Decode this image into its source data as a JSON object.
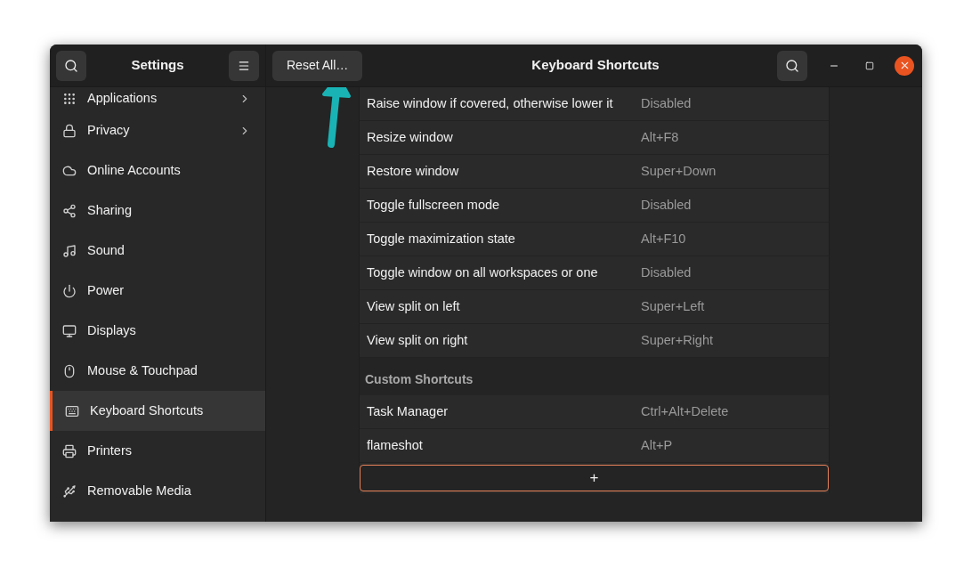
{
  "sidebar": {
    "title": "Settings",
    "items": [
      {
        "label": "Applications",
        "submenu": true,
        "selected": false
      },
      {
        "label": "Privacy",
        "submenu": true,
        "selected": false
      },
      {
        "label": "Online Accounts",
        "submenu": false,
        "selected": false
      },
      {
        "label": "Sharing",
        "submenu": false,
        "selected": false
      },
      {
        "label": "Sound",
        "submenu": false,
        "selected": false
      },
      {
        "label": "Power",
        "submenu": false,
        "selected": false
      },
      {
        "label": "Displays",
        "submenu": false,
        "selected": false
      },
      {
        "label": "Mouse & Touchpad",
        "submenu": false,
        "selected": false
      },
      {
        "label": "Keyboard Shortcuts",
        "submenu": false,
        "selected": true
      },
      {
        "label": "Printers",
        "submenu": false,
        "selected": false
      },
      {
        "label": "Removable Media",
        "submenu": false,
        "selected": false
      }
    ]
  },
  "header": {
    "reset_button": "Reset All…",
    "title": "Keyboard Shortcuts"
  },
  "shortcuts": [
    {
      "kind": "row",
      "name": "Raise window if covered, otherwise lower it",
      "keys": "Disabled"
    },
    {
      "kind": "row",
      "name": "Resize window",
      "keys": "Alt+F8"
    },
    {
      "kind": "row",
      "name": "Restore window",
      "keys": "Super+Down"
    },
    {
      "kind": "row",
      "name": "Toggle fullscreen mode",
      "keys": "Disabled"
    },
    {
      "kind": "row",
      "name": "Toggle maximization state",
      "keys": "Alt+F10"
    },
    {
      "kind": "row",
      "name": "Toggle window on all workspaces or one",
      "keys": "Disabled"
    },
    {
      "kind": "row",
      "name": "View split on left",
      "keys": "Super+Left"
    },
    {
      "kind": "row",
      "name": "View split on right",
      "keys": "Super+Right"
    },
    {
      "kind": "heading",
      "name": "Custom Shortcuts"
    },
    {
      "kind": "row",
      "name": "Task Manager",
      "keys": "Ctrl+Alt+Delete"
    },
    {
      "kind": "row",
      "name": "flameshot",
      "keys": "Alt+P"
    }
  ],
  "add_button": "+"
}
